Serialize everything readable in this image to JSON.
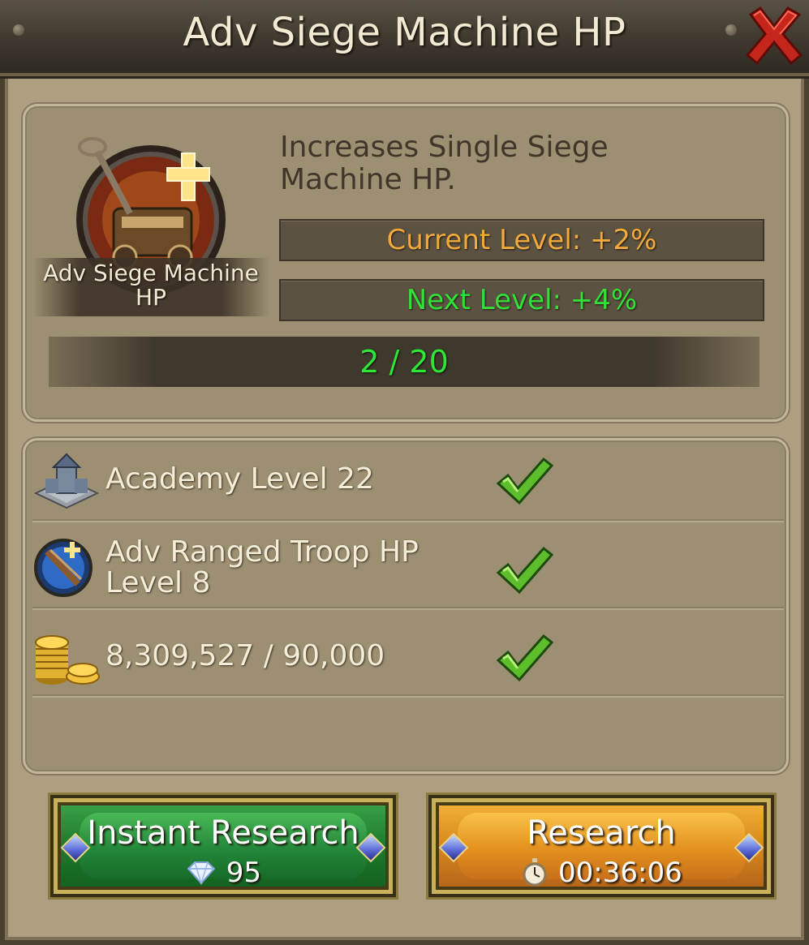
{
  "window": {
    "title": "Adv Siege Machine HP",
    "close_icon": "close-x-icon"
  },
  "research": {
    "icon_name": "siege-machine-research-icon",
    "icon_label": "Adv Siege Machine HP",
    "description": "Increases Single Siege Machine HP.",
    "current_level": "Current Level: +2%",
    "next_level": "Next Level: +4%",
    "progress_text": "2 / 20",
    "progress_value": 2,
    "progress_max": 20
  },
  "requirements": [
    {
      "icon": "academy-building-icon",
      "text": "Academy Level 22",
      "met": true
    },
    {
      "icon": "ranged-troop-hp-icon",
      "text": "Adv Ranged Troop HP Level 8",
      "met": true
    },
    {
      "icon": "gold-coins-icon",
      "text": "8,309,527 / 90,000",
      "met": true
    }
  ],
  "buttons": {
    "instant": {
      "label": "Instant Research",
      "cost": "95",
      "cost_icon": "diamond-icon"
    },
    "research": {
      "label": "Research",
      "time": "00:36:06",
      "time_icon": "stopwatch-icon"
    }
  },
  "colors": {
    "current_level": "#f2aa3c",
    "next_level": "#33e038",
    "progress": "#2de636",
    "instant_button": "#23873a",
    "research_button": "#e3901e"
  }
}
